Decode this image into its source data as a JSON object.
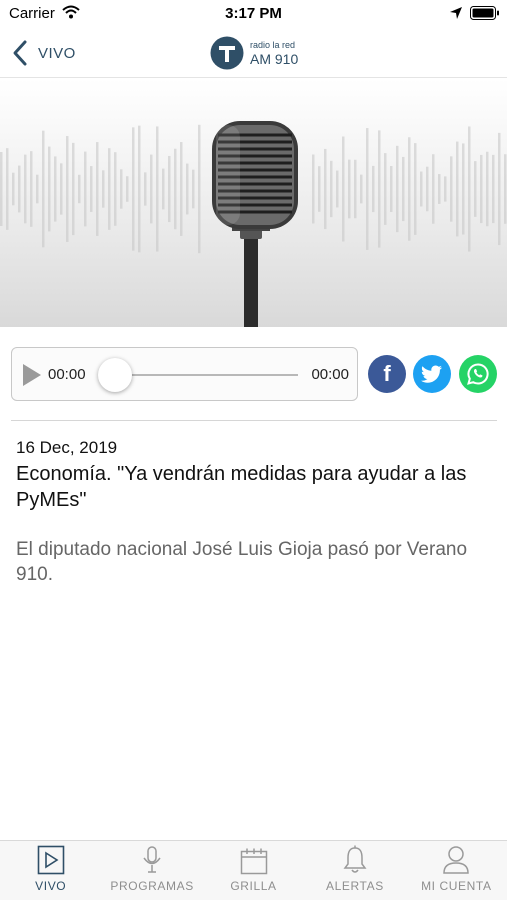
{
  "status_bar": {
    "carrier": "Carrier",
    "time": "3:17 PM"
  },
  "nav": {
    "back_label": "VIVO",
    "logo_small": "radio la red",
    "logo_big": "AM 910"
  },
  "player": {
    "current_time": "00:00",
    "total_time": "00:00",
    "progress": 0
  },
  "share": {
    "facebook": "f",
    "twitter": "twitter-icon",
    "whatsapp": "whatsapp-icon"
  },
  "article": {
    "date": "16 Dec, 2019",
    "headline": "Economía. \"Ya vendrán medidas para ayudar a las PyMEs\"",
    "summary": "El diputado nacional José Luis Gioja pasó por Verano 910."
  },
  "tabs": [
    {
      "label": "VIVO",
      "icon": "play-square-icon",
      "active": true
    },
    {
      "label": "PROGRAMAS",
      "icon": "microphone-icon",
      "active": false
    },
    {
      "label": "GRILLA",
      "icon": "calendar-icon",
      "active": false
    },
    {
      "label": "ALERTAS",
      "icon": "bell-icon",
      "active": false
    },
    {
      "label": "MI CUENTA",
      "icon": "user-icon",
      "active": false
    }
  ],
  "colors": {
    "accent": "#2f4f67",
    "facebook": "#3b5998",
    "twitter": "#1da1f2",
    "whatsapp": "#25d366"
  }
}
